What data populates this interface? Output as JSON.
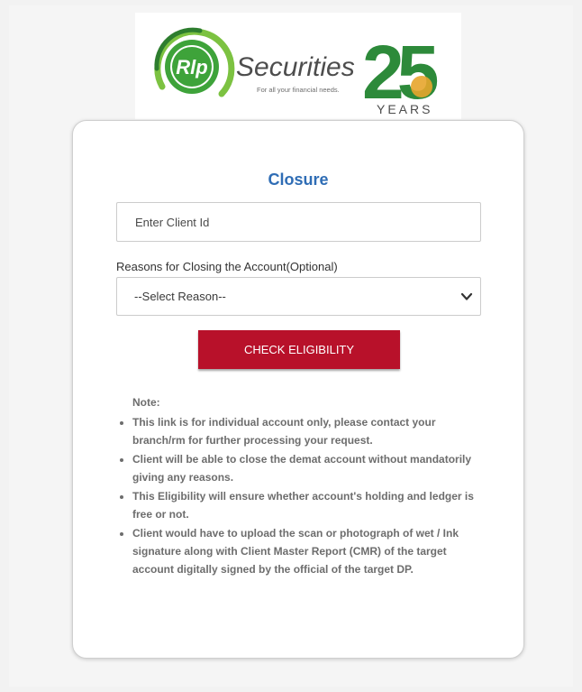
{
  "logo": {
    "mark_text": "Rlp",
    "brand": "Securities",
    "tagline": "For all your financial needs.",
    "anniversary_number": "25",
    "anniversary_word": "YEARS",
    "colors": {
      "green": "#3ea33a",
      "dark_green": "#2d7d2e",
      "gold": "#e7a52c",
      "grey": "#4d4d4d"
    }
  },
  "form": {
    "title": "Closure",
    "client_id": {
      "value": "",
      "placeholder": "Enter Client Id"
    },
    "reason_label": "Reasons for Closing the Account(Optional)",
    "reason_select": {
      "selected": "--Select Reason--"
    },
    "check_button_label": "CHECK ELIGIBILITY"
  },
  "note": {
    "title": "Note:",
    "items": [
      "This link is for individual account only, please contact your branch/rm for further processing your request.",
      "Client will be able to close the demat account without mandatorily giving any reasons.",
      "This Eligibility will ensure whether account's holding and ledger is free or not.",
      "Client would have to upload the scan or photograph of wet / Ink signature along with Client Master Report (CMR) of the target account digitally signed by the official of the target DP."
    ]
  },
  "theme": {
    "title_color": "#2f6db5",
    "button_color": "#b8112a",
    "note_color": "#6d6d6d"
  }
}
